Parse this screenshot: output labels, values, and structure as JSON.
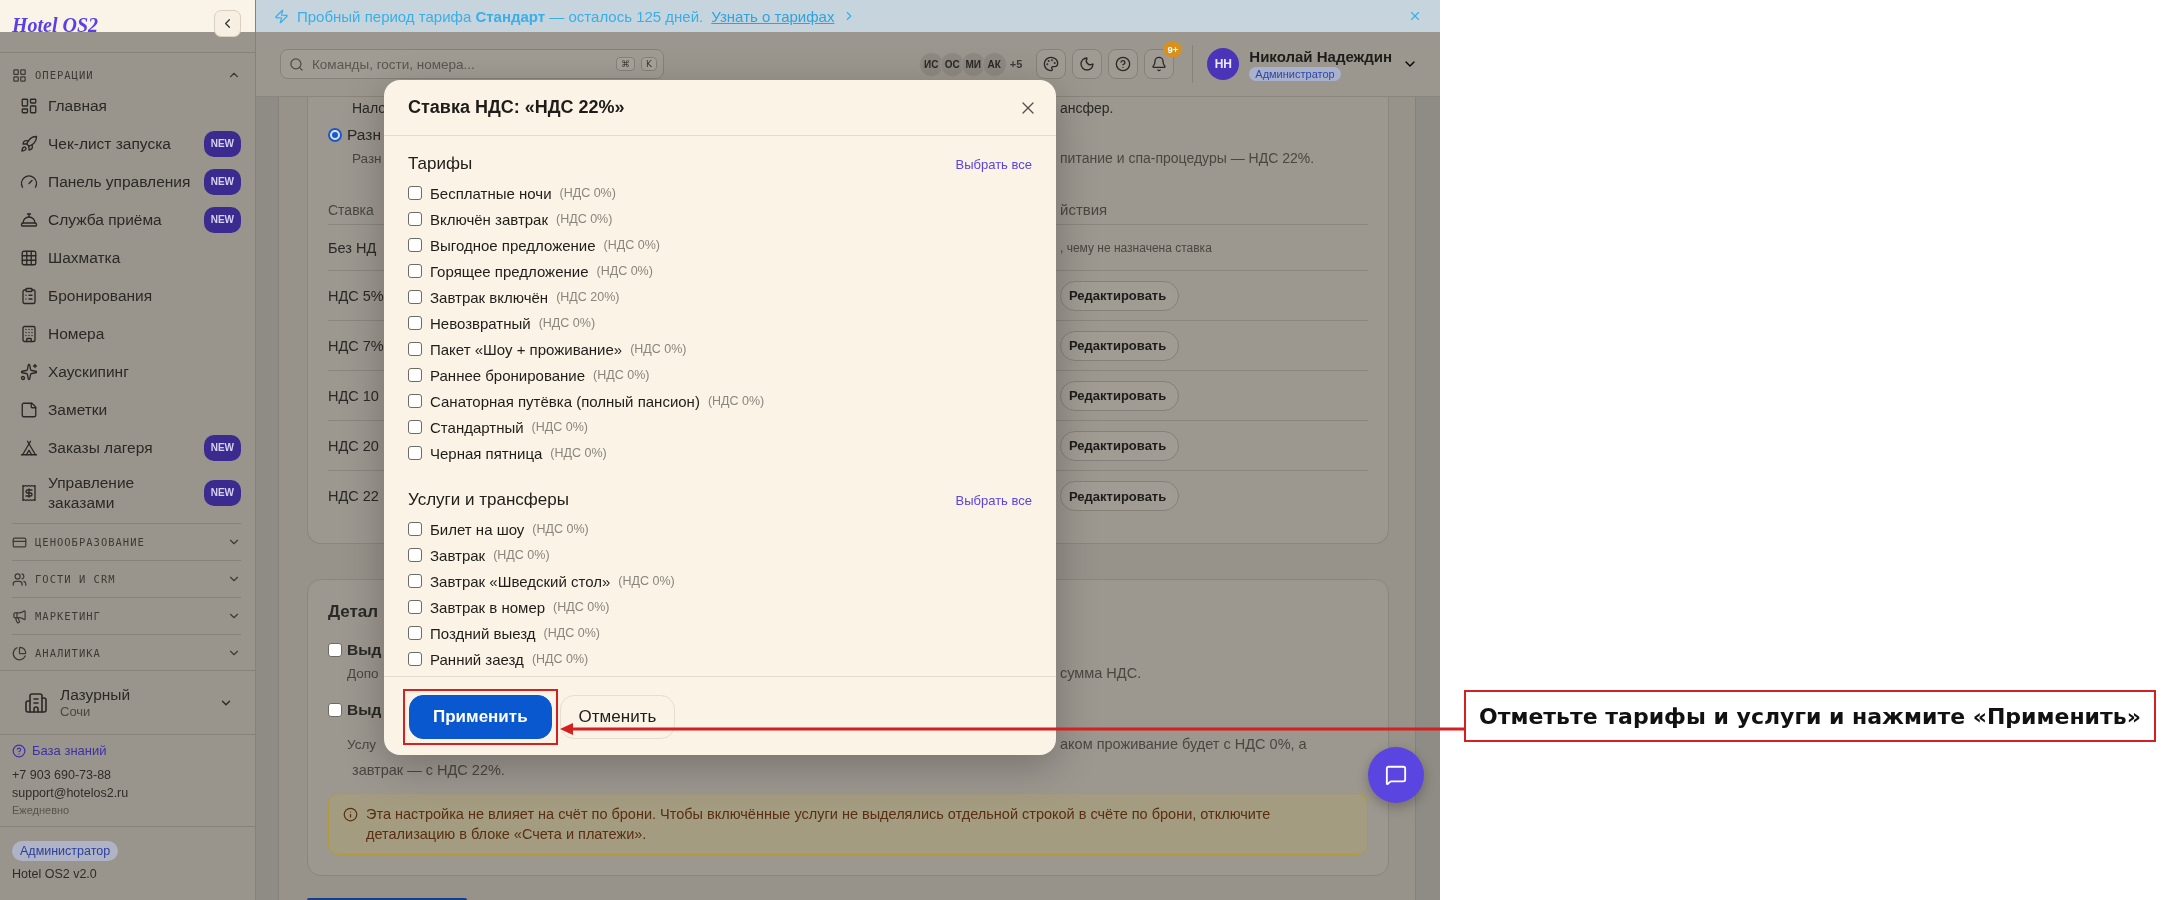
{
  "banner": {
    "message": "Пробный период тарифа **Стандарт** — осталось 125 дней.",
    "link": "Узнать о тарифах"
  },
  "sidebar": {
    "logo": "Hotel OS2",
    "sections": [
      {
        "label": "ОПЕРАЦИИ",
        "expanded": true,
        "items": [
          {
            "label": "Главная"
          },
          {
            "label": "Чек-лист запуска",
            "badge": "NEW"
          },
          {
            "label": "Панель управления",
            "badge": "NEW"
          },
          {
            "label": "Служба приёма",
            "badge": "NEW"
          },
          {
            "label": "Шахматка"
          },
          {
            "label": "Бронирования"
          },
          {
            "label": "Номера"
          },
          {
            "label": "Хаускипинг"
          },
          {
            "label": "Заметки"
          },
          {
            "label": "Заказы лагеря",
            "badge": "NEW"
          },
          {
            "label": "Управление заказами",
            "badge": "NEW"
          }
        ]
      },
      {
        "label": "ЦЕНООБРАЗОВАНИЕ",
        "expanded": false
      },
      {
        "label": "ГОСТИ И CRM",
        "expanded": false
      },
      {
        "label": "МАРКЕТИНГ",
        "expanded": false
      },
      {
        "label": "АНАЛИТИКА",
        "expanded": false
      }
    ],
    "property": {
      "name": "Лазурный",
      "city": "Сочи"
    },
    "help_link": "База знаний",
    "phone": "+7 903 690-73-88",
    "email": "support@hotelos2.ru",
    "hours": "Ежедневно",
    "role": "Администратор",
    "version": "Hotel OS2 v2.0"
  },
  "header": {
    "search": {
      "placeholder": "Команды, гости, номера...",
      "keys": [
        "⌘",
        "K"
      ]
    },
    "team": [
      "ИС",
      "ОС",
      "МИ",
      "АК"
    ],
    "team_more": "+5",
    "notifications": "9+",
    "user": {
      "initials": "НН",
      "name": "Николай Надеждин",
      "role": "Администратор"
    }
  },
  "settings_card": {
    "top_left": "Нало",
    "top_right": "ансфер.",
    "option": {
      "selected": true,
      "label": "Разн",
      "desc_left": "Разн",
      "desc_right": "питание и спа-процедуры — НДС 22%."
    },
    "table": {
      "columns": [
        "Ставка",
        "йствия"
      ],
      "rows": [
        {
          "rate": "Без НД",
          "note": ", чему не назначена ставка"
        },
        {
          "rate": "НДС 5%",
          "action": "Редактировать"
        },
        {
          "rate": "НДС 7%",
          "action": "Редактировать"
        },
        {
          "rate": "НДС 10",
          "action": "Редактировать"
        },
        {
          "rate": "НДС 20",
          "action": "Редактировать"
        },
        {
          "rate": "НДС 22",
          "action": "Редактировать"
        }
      ]
    }
  },
  "details_card": {
    "title": "Детал",
    "options": [
      {
        "checked": false,
        "label": "Выд",
        "desc_left": "Допо",
        "desc_right": "сумма НДС."
      },
      {
        "checked": false,
        "label": "Выд",
        "desc_left": "Услу",
        "desc_right": "аком проживание будет с НДС 0%, а",
        "desc_next": "завтрак — с НДС 22%."
      }
    ],
    "info": "Эта настройка не влияет на счёт по брони. Чтобы включённые услуги не выделялись отдельной строкой в счёте по брони, отключите детализацию в блоке «Счета и платежи»."
  },
  "modal": {
    "title": "Ставка НДС: «НДС 22%»",
    "groups": [
      {
        "title": "Тарифы",
        "select_all": "Выбрать все",
        "options": [
          {
            "label": "Бесплатные ночи",
            "vat": "(НДС 0%)",
            "checked": false
          },
          {
            "label": "Включён завтрак",
            "vat": "(НДС 0%)",
            "checked": false
          },
          {
            "label": "Выгодное предложение",
            "vat": "(НДС 0%)",
            "checked": false
          },
          {
            "label": "Горящее предложение",
            "vat": "(НДС 0%)",
            "checked": false
          },
          {
            "label": "Завтрак включён",
            "vat": "(НДС 20%)",
            "checked": false
          },
          {
            "label": "Невозвратный",
            "vat": "(НДС 0%)",
            "checked": false
          },
          {
            "label": "Пакет «Шоу + проживание»",
            "vat": "(НДС 0%)",
            "checked": false
          },
          {
            "label": "Раннее бронирование",
            "vat": "(НДС 0%)",
            "checked": false
          },
          {
            "label": "Санаторная путёвка (полный пансион)",
            "vat": "(НДС 0%)",
            "checked": false
          },
          {
            "label": "Стандартный",
            "vat": "(НДС 0%)",
            "checked": false
          },
          {
            "label": "Черная пятница",
            "vat": "(НДС 0%)",
            "checked": false
          }
        ]
      },
      {
        "title": "Услуги и трансферы",
        "select_all": "Выбрать все",
        "options": [
          {
            "label": "Билет на шоу",
            "vat": "(НДС 0%)",
            "checked": false
          },
          {
            "label": "Завтрак",
            "vat": "(НДС 0%)",
            "checked": false
          },
          {
            "label": "Завтрак «Шведский стол»",
            "vat": "(НДС 0%)",
            "checked": false
          },
          {
            "label": "Завтрак в номер",
            "vat": "(НДС 0%)",
            "checked": false
          },
          {
            "label": "Поздний выезд",
            "vat": "(НДС 0%)",
            "checked": false
          },
          {
            "label": "Ранний заезд",
            "vat": "(НДС 0%)",
            "checked": false
          }
        ]
      }
    ],
    "buttons": [
      {
        "label": "Применить",
        "kind": "primary"
      },
      {
        "label": "Отменить",
        "kind": "secondary"
      }
    ]
  },
  "annotation": {
    "text": "Отметьте тарифы и услуги и нажмите «Применить»"
  }
}
